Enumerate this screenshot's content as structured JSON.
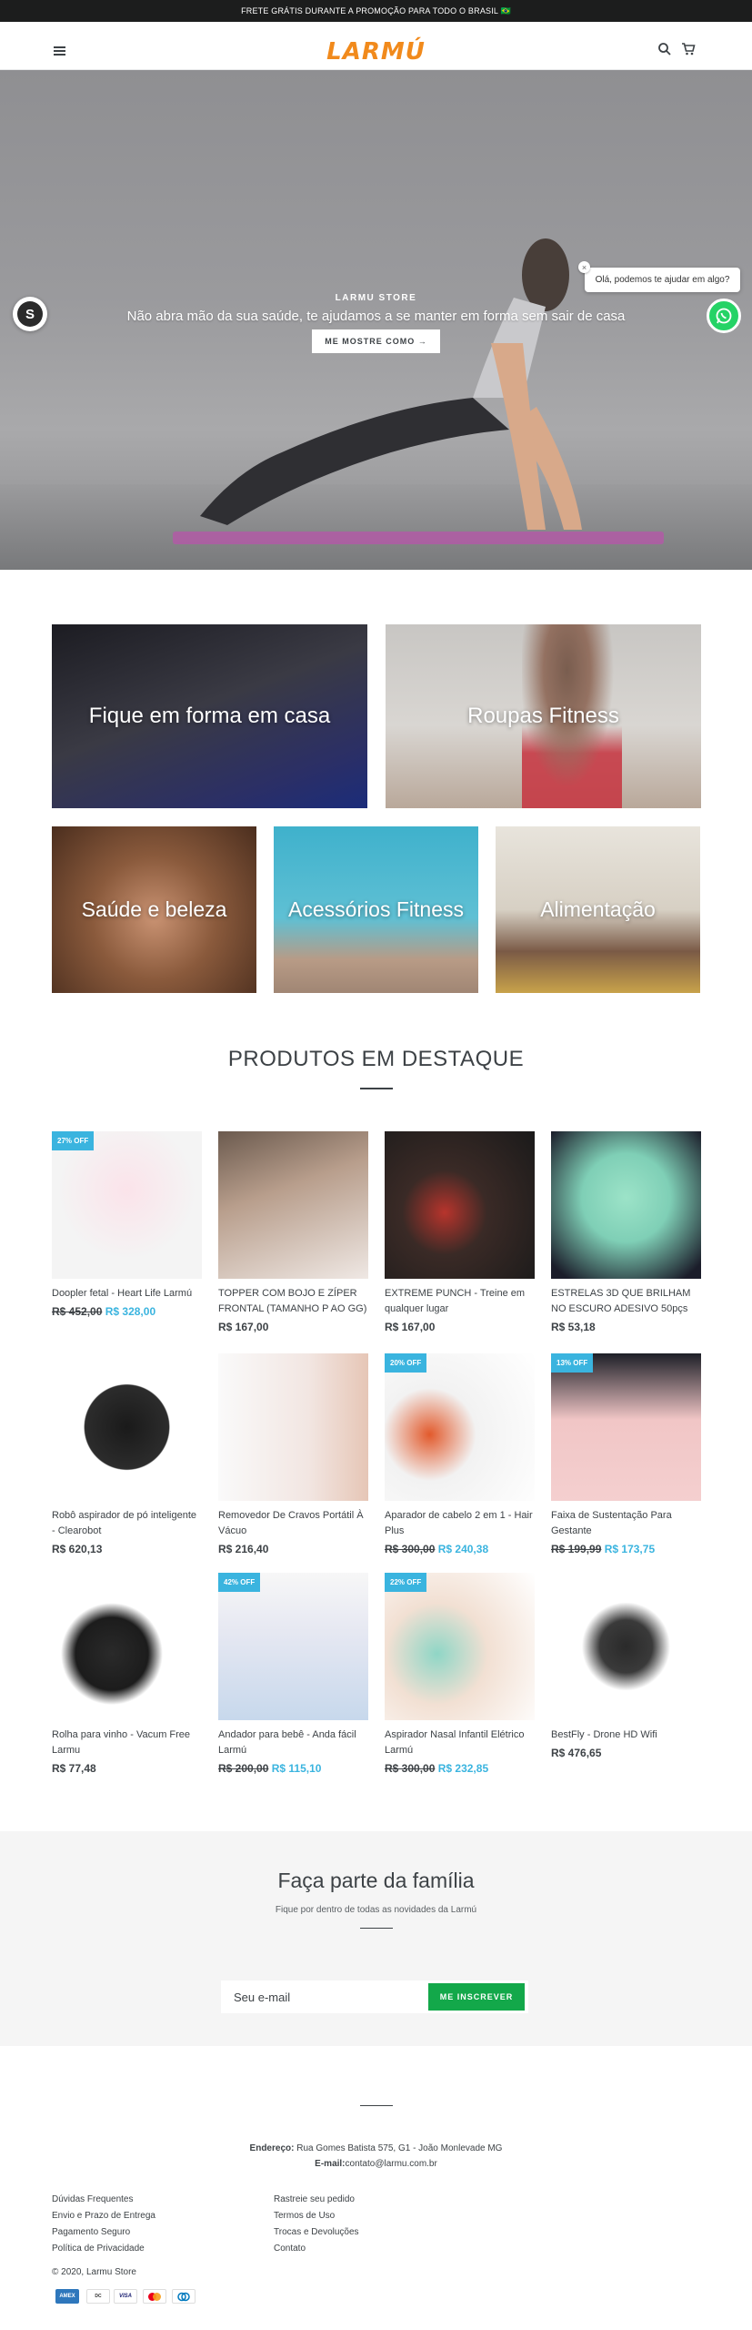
{
  "announcement": "FRETE GRÁTIS DURANTE A PROMOÇÃO PARA TODO O BRASIL 🇧🇷",
  "header": {
    "logo": "LARMÚ"
  },
  "hero": {
    "subheading": "LARMU STORE",
    "title": "Não abra mão da sua saúde, te ajudamos a se manter em forma sem sair de casa",
    "button": "ME MOSTRE COMO →"
  },
  "whatsapp": {
    "bubble": "Olá, podemos te ajudar em algo?",
    "close": "×"
  },
  "collections": [
    {
      "label": "Fique em forma em casa"
    },
    {
      "label": "Roupas Fitness"
    },
    {
      "label": "Saúde e beleza"
    },
    {
      "label": "Acessórios Fitness"
    },
    {
      "label": "Alimentação"
    }
  ],
  "featured": {
    "title": "PRODUTOS EM DESTAQUE",
    "products": [
      {
        "badge": "27% OFF",
        "name": "Doopler fetal - Heart Life Larmú",
        "old_price": "R$ 452,00",
        "price": "R$ 328,00"
      },
      {
        "badge": "",
        "name": "TOPPER COM BOJO E ZÍPER FRONTAL (TAMANHO P AO GG)",
        "old_price": "",
        "price": "R$ 167,00"
      },
      {
        "badge": "",
        "name": "EXTREME PUNCH - Treine em qualquer lugar",
        "old_price": "",
        "price": "R$ 167,00"
      },
      {
        "badge": "",
        "name": "ESTRELAS 3D QUE BRILHAM NO ESCURO ADESIVO 50pçs",
        "old_price": "",
        "price": "R$ 53,18"
      },
      {
        "badge": "",
        "name": "Robô aspirador de pó inteligente - Clearobot",
        "old_price": "",
        "price": "R$ 620,13"
      },
      {
        "badge": "",
        "name": "Removedor De Cravos Portátil À Vácuo",
        "old_price": "",
        "price": "R$ 216,40"
      },
      {
        "badge": "20% OFF",
        "name": "Aparador de cabelo 2 em 1 - Hair Plus",
        "old_price": "R$ 300,00",
        "price": "R$ 240,38"
      },
      {
        "badge": "13% OFF",
        "name": "Faixa de Sustentação Para Gestante",
        "old_price": "R$ 199,99",
        "price": "R$ 173,75"
      },
      {
        "badge": "",
        "name": "Rolha para vinho - Vacum Free Larmu",
        "old_price": "",
        "price": "R$ 77,48"
      },
      {
        "badge": "42% OFF",
        "name": "Andador para bebê - Anda fácil Larmú",
        "old_price": "R$ 200,00",
        "price": "R$ 115,10"
      },
      {
        "badge": "22% OFF",
        "name": "Aspirador Nasal Infantil Elétrico Larmú",
        "old_price": "R$ 300,00",
        "price": "R$ 232,85"
      },
      {
        "badge": "",
        "name": "BestFly - Drone HD Wifi",
        "old_price": "",
        "price": "R$ 476,65"
      }
    ]
  },
  "newsletter": {
    "title": "Faça parte da família",
    "subtitle": "Fique por dentro de todas as novidades da Larmú",
    "placeholder": "Seu e-mail",
    "button": "ME INSCREVER"
  },
  "footer": {
    "address_label": "Endereço:",
    "address": " Rua Gomes Batista 575, G1 - João Monlevade MG",
    "email_label": "E-mail:",
    "email": "contato@larmu.com.br",
    "links_left": [
      "Dúvidas Frequentes",
      "Envio e Prazo de Entrega",
      "Pagamento Seguro",
      "Política de Privacidade"
    ],
    "links_right": [
      "Rastreie seu pedido",
      "Termos de Uso",
      "Trocas e Devoluções",
      "Contato"
    ],
    "copyright": "© 2020, Larmu Store",
    "payments": [
      {
        "name": "AMEX",
        "color": "#2e77bc"
      },
      {
        "name": "DINERS",
        "color": "#ffffff"
      },
      {
        "name": "VISA",
        "color": "#ffffff"
      },
      {
        "name": "MC",
        "color": "#ffffff"
      },
      {
        "name": "DISC",
        "color": "#ffffff"
      }
    ]
  }
}
